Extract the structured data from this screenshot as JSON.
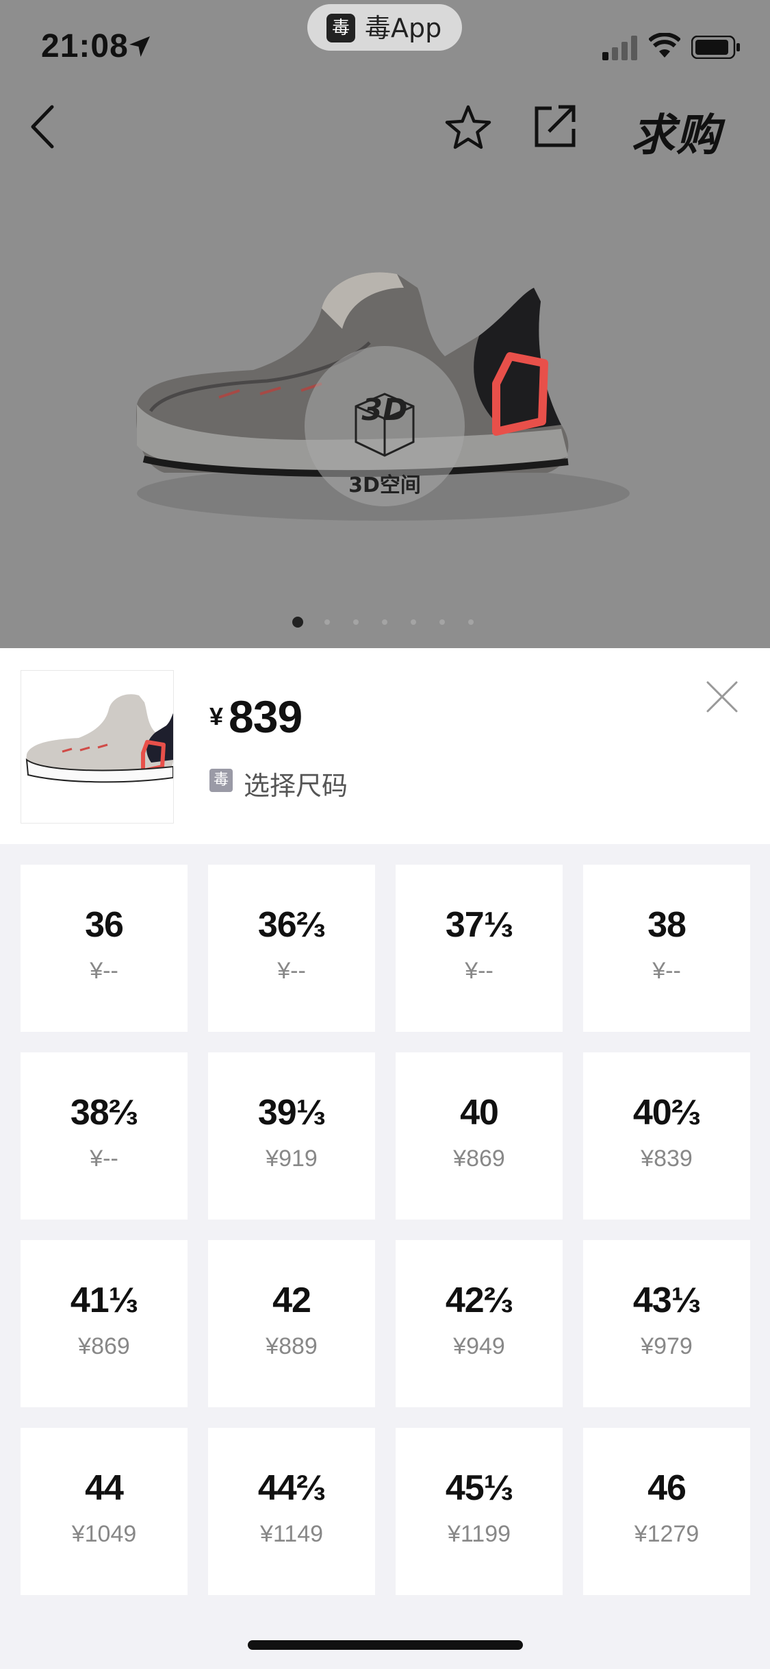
{
  "status_bar": {
    "time": "21:08",
    "app_pill_icon": "毒",
    "app_pill_label": "毒App"
  },
  "nav": {
    "want_label": "求购"
  },
  "hero": {
    "badge_3d_label": "3D空间",
    "page_count": 7,
    "active_page": 1
  },
  "sheet": {
    "price_currency": "¥",
    "price": "839",
    "select_hint_icon": "毒",
    "select_hint": "选择尺码"
  },
  "sizes": [
    {
      "label": "36",
      "price": "¥--"
    },
    {
      "label": "36⅔",
      "price": "¥--"
    },
    {
      "label": "37⅓",
      "price": "¥--"
    },
    {
      "label": "38",
      "price": "¥--"
    },
    {
      "label": "38⅔",
      "price": "¥--"
    },
    {
      "label": "39⅓",
      "price": "¥919"
    },
    {
      "label": "40",
      "price": "¥869"
    },
    {
      "label": "40⅔",
      "price": "¥839"
    },
    {
      "label": "41⅓",
      "price": "¥869"
    },
    {
      "label": "42",
      "price": "¥889"
    },
    {
      "label": "42⅔",
      "price": "¥949"
    },
    {
      "label": "43⅓",
      "price": "¥979"
    },
    {
      "label": "44",
      "price": "¥1049"
    },
    {
      "label": "44⅔",
      "price": "¥1149"
    },
    {
      "label": "45⅓",
      "price": "¥1199"
    },
    {
      "label": "46",
      "price": "¥1279"
    }
  ],
  "colors": {
    "overlay": "#8e8e8e",
    "sheet_bg": "#f2f2f6",
    "accent_shoe": "#e8504a"
  },
  "icons": [
    "location-arrow-icon",
    "signal-icon",
    "wifi-icon",
    "battery-icon",
    "back-chevron-icon",
    "star-icon",
    "share-icon",
    "cube-3d-icon",
    "close-icon"
  ]
}
